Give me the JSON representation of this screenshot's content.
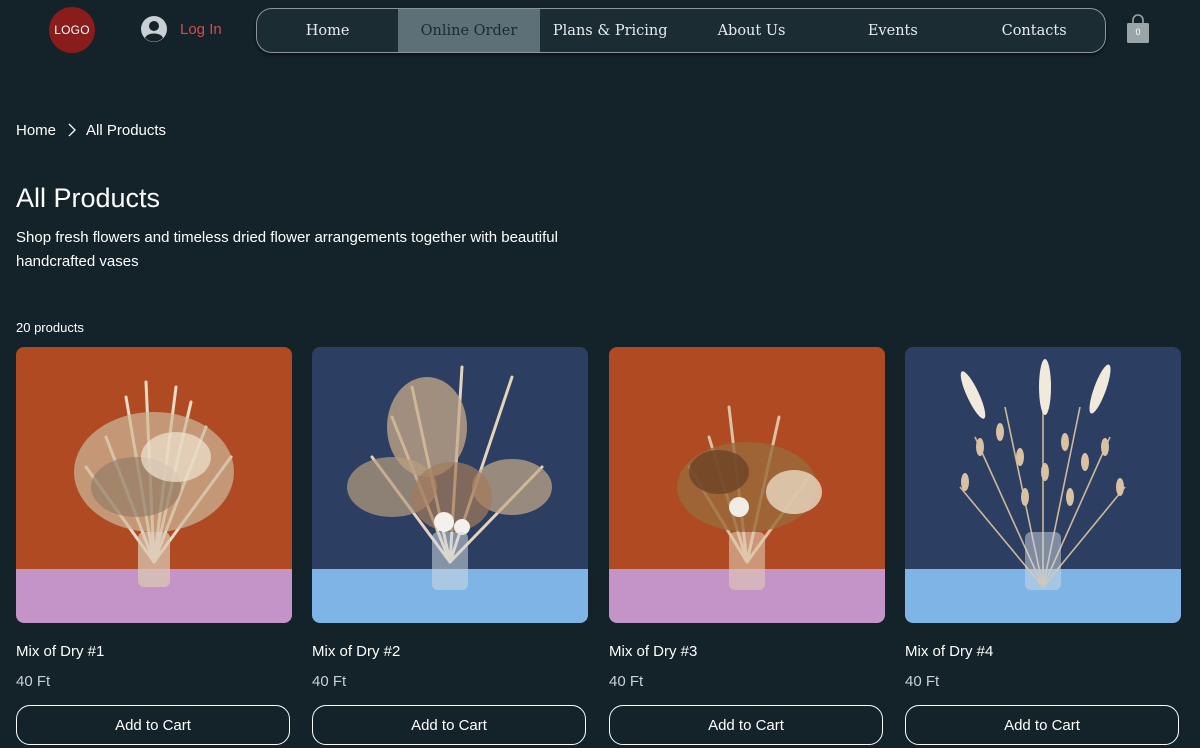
{
  "header": {
    "logo_text": "LOGO",
    "login_label": "Log In",
    "cart_count": "0",
    "nav": [
      {
        "label": "Home",
        "active": false
      },
      {
        "label": "Online Order",
        "active": true
      },
      {
        "label": "Plans & Pricing",
        "active": false
      },
      {
        "label": "About Us",
        "active": false
      },
      {
        "label": "Events",
        "active": false
      },
      {
        "label": "Contacts",
        "active": false
      }
    ]
  },
  "breadcrumb": {
    "home": "Home",
    "current": "All Products"
  },
  "main": {
    "title": "All Products",
    "description": "Shop fresh flowers and timeless dried flower arrangements together with beautiful handcrafted vases",
    "product_count": "20 products"
  },
  "products": [
    {
      "name": "Mix of Dry #1",
      "price": "40 Ft",
      "button": "Add to Cart",
      "bg_top": "#b04a23",
      "bg_floor": "#c493c8"
    },
    {
      "name": "Mix of Dry #2",
      "price": "40 Ft",
      "button": "Add to Cart",
      "bg_top": "#2c3e62",
      "bg_floor": "#7fb4e6"
    },
    {
      "name": "Mix of Dry #3",
      "price": "40 Ft",
      "button": "Add to Cart",
      "bg_top": "#b04a23",
      "bg_floor": "#c493c8"
    },
    {
      "name": "Mix of Dry #4",
      "price": "40 Ft",
      "button": "Add to Cart",
      "bg_top": "#2c3e62",
      "bg_floor": "#7fb4e6"
    }
  ],
  "colors": {
    "background": "#142229",
    "accent_login": "#d94a4a",
    "nav_active": "#5d7077",
    "logo_bg": "#8a1c1c"
  }
}
